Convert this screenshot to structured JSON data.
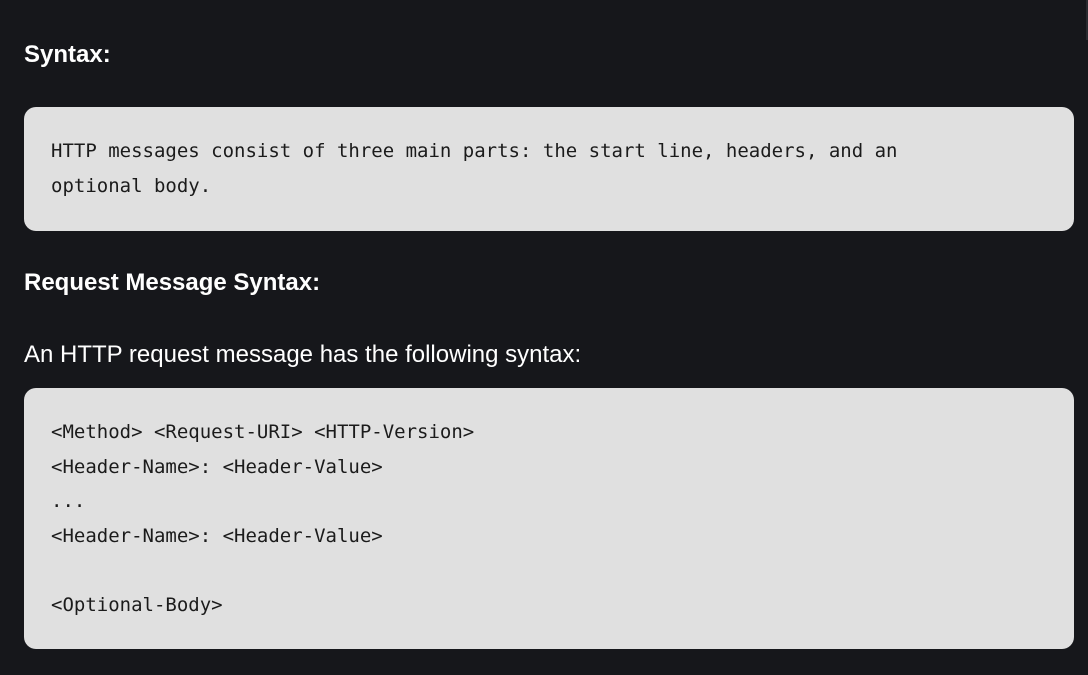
{
  "section_syntax": {
    "heading": "Syntax:",
    "code_text": "HTTP messages consist of three main parts: the start line, headers, and an optional body."
  },
  "section_request": {
    "heading": "Request Message Syntax:",
    "intro": "An HTTP request message has the following syntax:",
    "code_lines": [
      "<Method> <Request-URI> <HTTP-Version>",
      "<Header-Name>: <Header-Value>",
      "...",
      "<Header-Name>: <Header-Value>",
      "",
      "<Optional-Body>"
    ]
  }
}
